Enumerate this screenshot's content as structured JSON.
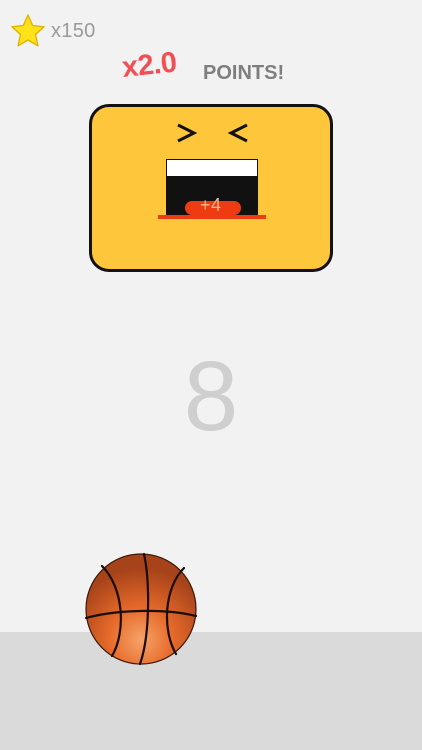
{
  "hud": {
    "coin_count": "x150",
    "multiplier": "x2.0",
    "points_label": "POINTS!"
  },
  "hoop": {
    "bonus": "+4"
  },
  "score": "8",
  "icons": {
    "coin": "star-icon",
    "ball": "basketball-icon"
  },
  "colors": {
    "background": "#f2f2f2",
    "floor": "#dadada",
    "accent_red": "#f14f53",
    "hoop_yellow": "#fec63a",
    "rim_red": "#ee3b12",
    "star_yellow": "#ffe21a",
    "ball_orange": "#e66a2a"
  }
}
